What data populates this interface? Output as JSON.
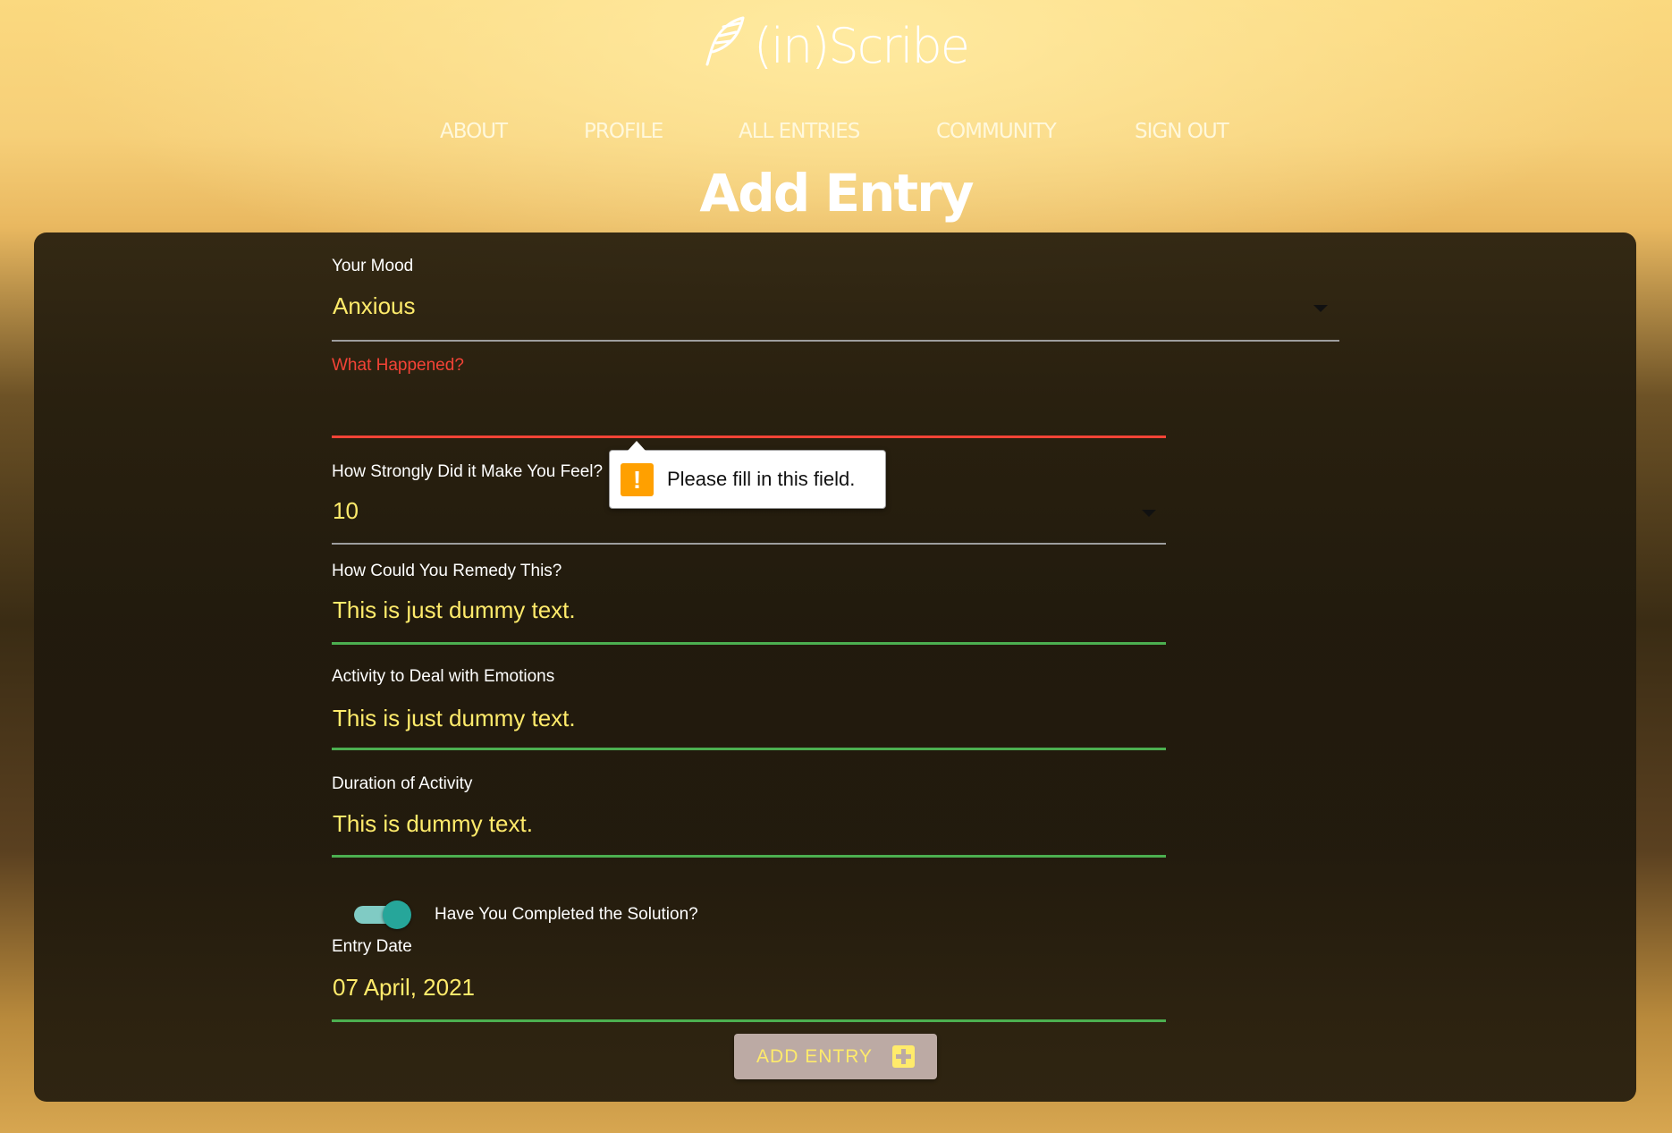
{
  "app": {
    "name": "(in)Scribe"
  },
  "nav": [
    "ABOUT",
    "PROFILE",
    "ALL ENTRIES",
    "COMMUNITY",
    "SIGN OUT"
  ],
  "page_title": "Add Entry",
  "form": {
    "mood": {
      "label": "Your Mood",
      "value": "Anxious"
    },
    "what_happened": {
      "label": "What Happened?",
      "value": ""
    },
    "strength": {
      "label": "How Strongly Did it Make You Feel?",
      "value": "10"
    },
    "remedy": {
      "label": "How Could You Remedy This?",
      "value": "This is just dummy text."
    },
    "activity": {
      "label": "Activity to Deal with Emotions",
      "value": "This is just dummy text."
    },
    "duration": {
      "label": "Duration of Activity",
      "value": "This is dummy text."
    },
    "completed": {
      "label": "Have You Completed the Solution?",
      "checked": true
    },
    "entry_date": {
      "label": "Entry Date",
      "value": "07 April, 2021"
    },
    "submit_label": "ADD ENTRY"
  },
  "validation_tooltip": "Please fill in this field.",
  "colors": {
    "accent": "#ffeb6b",
    "error": "#f44336",
    "valid": "#4caf50",
    "toggle": "#26a69a",
    "button": "#bcaaa4"
  }
}
